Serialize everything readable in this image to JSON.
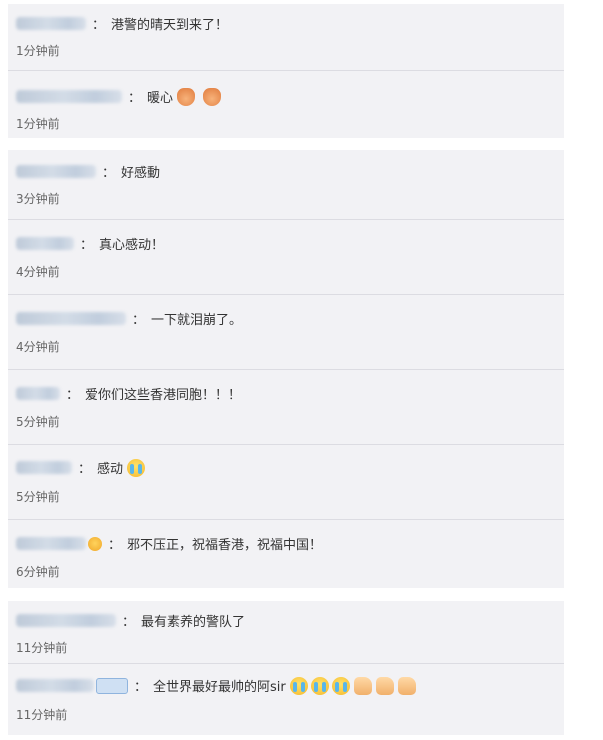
{
  "comments": [
    {
      "text": "港警的晴天到来了！",
      "time": "1分钟前"
    },
    {
      "text": "暖心",
      "time": "1分钟前"
    },
    {
      "text": "好感動",
      "time": "3分钟前"
    },
    {
      "text": "真心感动！",
      "time": "4分钟前"
    },
    {
      "text": "一下就泪崩了。",
      "time": "4分钟前"
    },
    {
      "text": "爱你们这些香港同胞！！！",
      "time": "5分钟前"
    },
    {
      "text": "感动",
      "time": "5分钟前"
    },
    {
      "text": "邪不压正，祝福香港，祝福中国！",
      "time": "6分钟前"
    },
    {
      "text": "最有素养的警队了",
      "time": "11分钟前"
    },
    {
      "text": "全世界最好最帅的阿sir",
      "time": "11分钟前"
    }
  ],
  "separator": "：",
  "icons": {
    "hands": "praying-hands-icon",
    "cry": "crying-face-icon",
    "thumb": "thumbs-up-icon",
    "face": "smiley-face-icon"
  },
  "colors": {
    "panel_bg": "#f2f2f5",
    "divider": "#dcdce2",
    "text": "#333333",
    "time": "#666666"
  }
}
